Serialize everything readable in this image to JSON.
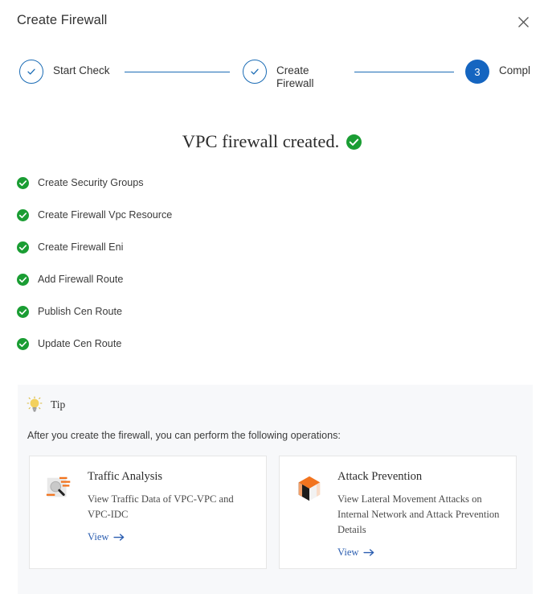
{
  "header": {
    "title": "Create Firewall",
    "close_icon": "close-icon"
  },
  "stepper": {
    "steps": [
      {
        "label": "Start Check",
        "state": "done",
        "number": "1",
        "icon": "check-icon"
      },
      {
        "label": "Create\nFirewall",
        "state": "done",
        "number": "2",
        "icon": "check-icon"
      },
      {
        "label": "Compl",
        "state": "active",
        "number": "3",
        "icon": ""
      }
    ]
  },
  "result": {
    "title": "VPC firewall created.",
    "status_icon": "green-check-circle-icon"
  },
  "tasks": [
    {
      "label": "Create Security Groups",
      "icon": "green-check-circle-icon"
    },
    {
      "label": "Create Firewall Vpc Resource",
      "icon": "green-check-circle-icon"
    },
    {
      "label": "Create Firewall Eni",
      "icon": "green-check-circle-icon"
    },
    {
      "label": "Add Firewall Route",
      "icon": "green-check-circle-icon"
    },
    {
      "label": "Publish Cen Route",
      "icon": "green-check-circle-icon"
    },
    {
      "label": "Update Cen Route",
      "icon": "green-check-circle-icon"
    }
  ],
  "tip": {
    "icon": "lightbulb-icon",
    "title": "Tip",
    "description": "After you create the firewall, you can perform the following operations:",
    "cards": [
      {
        "icon": "traffic-analysis-icon",
        "title": "Traffic Analysis",
        "description": "View Traffic Data of VPC-VPC and VPC-IDC",
        "link_label": "View",
        "link_icon": "arrow-right-icon"
      },
      {
        "icon": "attack-prevention-cube-icon",
        "title": "Attack Prevention",
        "description": "View Lateral Movement Attacks on Internal Network and Attack Prevention Details",
        "link_label": "View",
        "link_icon": "arrow-right-icon"
      }
    ]
  },
  "colors": {
    "accent_blue": "#1565c0",
    "step_outline_blue": "#1b6cb5",
    "success_green": "#1a9d33",
    "link_blue": "#2a5db0",
    "orange": "#f2741f",
    "panel_bg": "#f7f8fa"
  }
}
